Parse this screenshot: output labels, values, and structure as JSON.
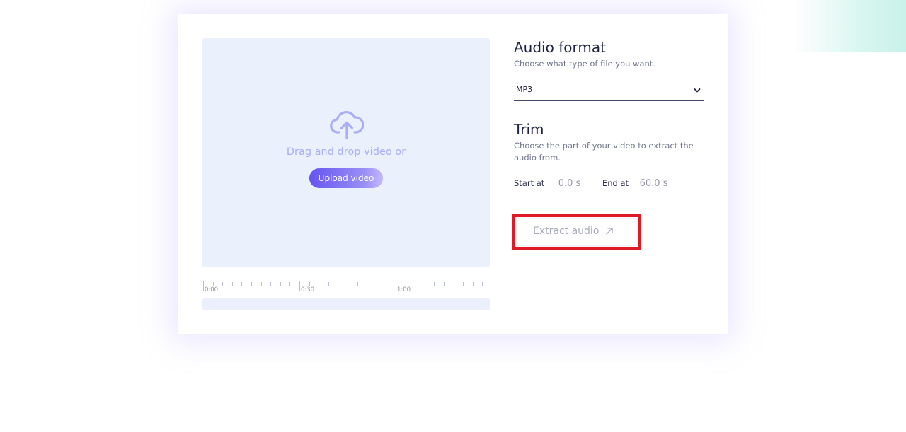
{
  "dropzone": {
    "prompt": "Drag and drop video or",
    "upload_label": "Upload video",
    "icon": "cloud-upload-icon"
  },
  "timeline": {
    "labels": [
      "0:00",
      "0:30",
      "1:00"
    ]
  },
  "audio_format": {
    "title": "Audio format",
    "subtitle": "Choose what type of file you want.",
    "selected": "MP3"
  },
  "trim": {
    "title": "Trim",
    "subtitle": "Choose the part of your video to extract the audio from.",
    "start_label": "Start at",
    "start_value": "0.0 s",
    "end_label": "End at",
    "end_value": "60.0 s"
  },
  "extract": {
    "label": "Extract audio",
    "icon": "arrow-up-right-icon"
  },
  "colors": {
    "accent": "#6455f1",
    "highlight": "#e01b26",
    "dropzone_bg": "#eaf1fd"
  }
}
